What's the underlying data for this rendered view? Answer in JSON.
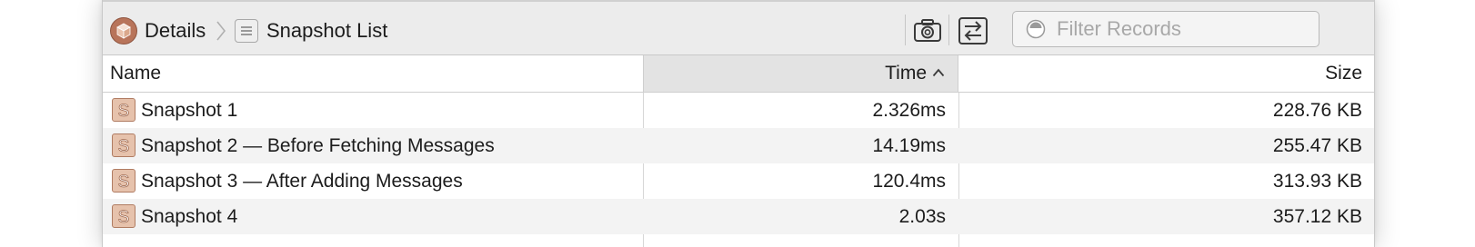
{
  "toolbar": {
    "breadcrumb": [
      {
        "label": "Details",
        "icon": "cube-icon"
      },
      {
        "label": "Snapshot List",
        "icon": "list-icon"
      }
    ],
    "separator_icon": "chevron-right-icon",
    "buttons": [
      {
        "name": "take-snapshot-button",
        "icon": "camera-icon"
      },
      {
        "name": "compare-snapshots-button",
        "icon": "swap-arrows-icon"
      }
    ],
    "filter": {
      "placeholder": "Filter Records",
      "value": "",
      "icon": "filter-icon"
    }
  },
  "table": {
    "columns": [
      {
        "key": "name",
        "label": "Name"
      },
      {
        "key": "time",
        "label": "Time",
        "sorted": "ascending",
        "sort_icon": "chevron-up-icon"
      },
      {
        "key": "size",
        "label": "Size"
      }
    ],
    "rows": [
      {
        "name": "Snapshot 1",
        "time": "2.326ms",
        "size": "228.76 KB"
      },
      {
        "name": "Snapshot 2 — Before Fetching Messages",
        "time": "14.19ms",
        "size": "255.47 KB"
      },
      {
        "name": "Snapshot 3 — After Adding Messages",
        "time": "120.4ms",
        "size": "313.93 KB"
      },
      {
        "name": "Snapshot 4",
        "time": "2.03s",
        "size": "357.12 KB"
      }
    ],
    "row_icon": "heap-snapshot-icon"
  },
  "colors": {
    "toolbar_bg": "#ececec",
    "sorted_header_bg": "#e3e3e3",
    "row_alt_bg": "#f3f3f3",
    "snapshot_icon_fill": "#e6c2ac",
    "snapshot_icon_stroke": "#b07c62",
    "cube_icon": "#b8745a"
  }
}
